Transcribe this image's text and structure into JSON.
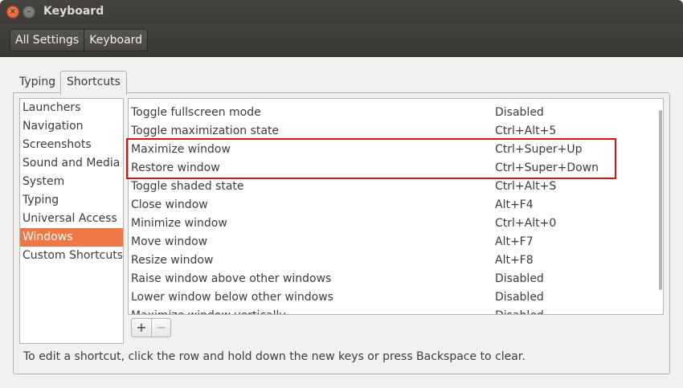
{
  "window": {
    "title": "Keyboard",
    "close_glyph": "×",
    "minimize_glyph": "–"
  },
  "breadcrumbs": [
    "All Settings",
    "Keyboard"
  ],
  "tabs": [
    {
      "label": "Typing",
      "active": false
    },
    {
      "label": "Shortcuts",
      "active": true
    }
  ],
  "sidebar": {
    "items": [
      "Launchers",
      "Navigation",
      "Screenshots",
      "Sound and Media",
      "System",
      "Typing",
      "Universal Access",
      "Windows",
      "Custom Shortcuts"
    ],
    "selected": "Windows"
  },
  "shortcuts": {
    "rows": [
      {
        "name": "Toggle fullscreen mode",
        "key": "Disabled"
      },
      {
        "name": "Toggle maximization state",
        "key": "Ctrl+Alt+5"
      },
      {
        "name": "Maximize window",
        "key": "Ctrl+Super+Up"
      },
      {
        "name": "Restore window",
        "key": "Ctrl+Super+Down"
      },
      {
        "name": "Toggle shaded state",
        "key": "Ctrl+Alt+S"
      },
      {
        "name": "Close window",
        "key": "Alt+F4"
      },
      {
        "name": "Minimize window",
        "key": "Ctrl+Alt+0"
      },
      {
        "name": "Move window",
        "key": "Alt+F7"
      },
      {
        "name": "Resize window",
        "key": "Alt+F8"
      },
      {
        "name": "Raise window above other windows",
        "key": "Disabled"
      },
      {
        "name": "Lower window below other windows",
        "key": "Disabled"
      },
      {
        "name": "Maximize window vertically",
        "key": "Disabled"
      }
    ],
    "highlighted": [
      "Maximize window",
      "Restore window"
    ]
  },
  "toolbar": {
    "add_label": "+",
    "remove_label": "−"
  },
  "hint": "To edit a shortcut, click the row and hold down the new keys or press Backspace to clear.",
  "colors": {
    "accent": "#f07746",
    "highlight_box": "#e01010"
  }
}
